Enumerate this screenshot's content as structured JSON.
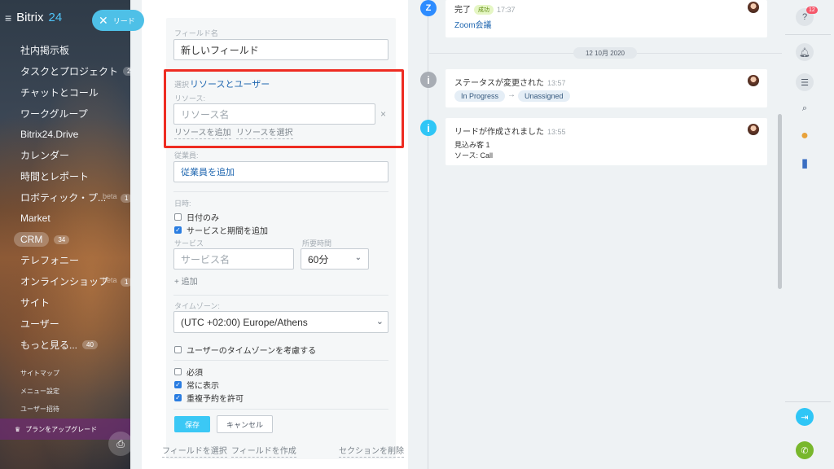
{
  "sidebar": {
    "logo_name": "Bitrix",
    "logo_num": "24",
    "items": [
      {
        "label": "社内掲示板"
      },
      {
        "label": "タスクとプロジェクト",
        "count": "26"
      },
      {
        "label": "チャットとコール"
      },
      {
        "label": "ワークグループ"
      },
      {
        "label": "Bitrix24.Drive"
      },
      {
        "label": "カレンダー"
      },
      {
        "label": "時間とレポート"
      },
      {
        "label": "ロボティック・プ...",
        "beta": "beta",
        "count_right": "1"
      },
      {
        "label": "Market"
      },
      {
        "label": "CRM",
        "count": "34"
      },
      {
        "label": "テレフォニー"
      },
      {
        "label": "オンラインショップ",
        "beta": "beta",
        "count_right": "1"
      },
      {
        "label": "サイト"
      },
      {
        "label": "ユーザー"
      },
      {
        "label": "もっと見る...",
        "count": "40"
      }
    ],
    "small_links": [
      "サイトマップ",
      "メニュー設定",
      "ユーザー招待"
    ],
    "upgrade": "プランをアップグレード"
  },
  "lead_button": {
    "label": "リード"
  },
  "editor": {
    "field_name_label": "フィールド名",
    "field_name_value": "新しいフィールド",
    "select_prefix": "選択",
    "select_link": "リソースとユーザー",
    "resource_label": "リソース:",
    "resource_placeholder": "リソース名",
    "add_resource": "リソースを追加",
    "select_resource": "リソースを選択",
    "employee_label": "従業員:",
    "add_employee": "従業員を追加",
    "date_label": "日時:",
    "date_only": "日付のみ",
    "add_service_duration": "サービスと期間を追加",
    "service_label": "サービス",
    "service_placeholder": "サービス名",
    "duration_label": "所要時間",
    "duration_value": "60分",
    "add_link": "+ 追加",
    "timezone_label": "タイムゾーン:",
    "timezone_value": "(UTC +02:00) Europe/Athens",
    "consider_tz": "ユーザーのタイムゾーンを考慮する",
    "required": "必須",
    "always_show": "常に表示",
    "allow_overbooking": "重複予約を許可",
    "save": "保存",
    "cancel": "キャンセル",
    "select_field": "フィールドを選択",
    "create_field": "フィールドを作成",
    "delete_section": "セクションを削除"
  },
  "timeline": {
    "card1": {
      "title": "完了",
      "badge": "成功",
      "time": "17:37",
      "link": "Zoom会議"
    },
    "date_separator": "12 10月 2020",
    "card2": {
      "title": "ステータスが変更された",
      "time": "13:57",
      "from": "In Progress",
      "arrow": "→",
      "to": "Unassigned"
    },
    "card3": {
      "title": "リードが作成されました",
      "time": "13:55",
      "line1": "見込み客 1",
      "line2": "ソース: Call"
    }
  },
  "right_bar": {
    "help_badge": "12"
  },
  "colors": {
    "accent": "#3bc8f5",
    "highlight": "#ee2c22",
    "link": "#2067b0"
  }
}
